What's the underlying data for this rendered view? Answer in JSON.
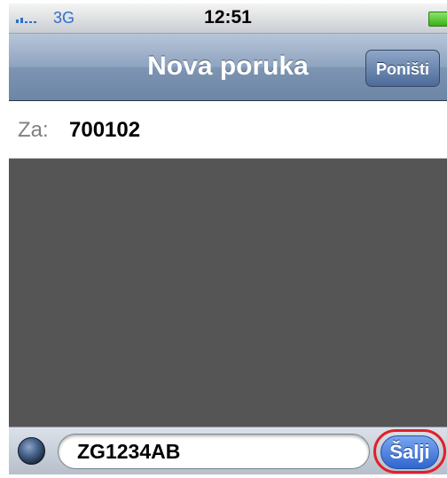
{
  "status_bar": {
    "carrier": "3G",
    "time": "12:51"
  },
  "nav": {
    "title": "Nova poruka",
    "cancel_label": "Poništi"
  },
  "recipient": {
    "label": "Za:",
    "value": "700102"
  },
  "compose": {
    "text": "ZG1234AB",
    "send_label": "Šalji"
  },
  "colors": {
    "nav_bar": "#7d94b2",
    "message_area": "#555555",
    "send_button": "#2f66d0",
    "highlight_ring": "#e0202a"
  }
}
